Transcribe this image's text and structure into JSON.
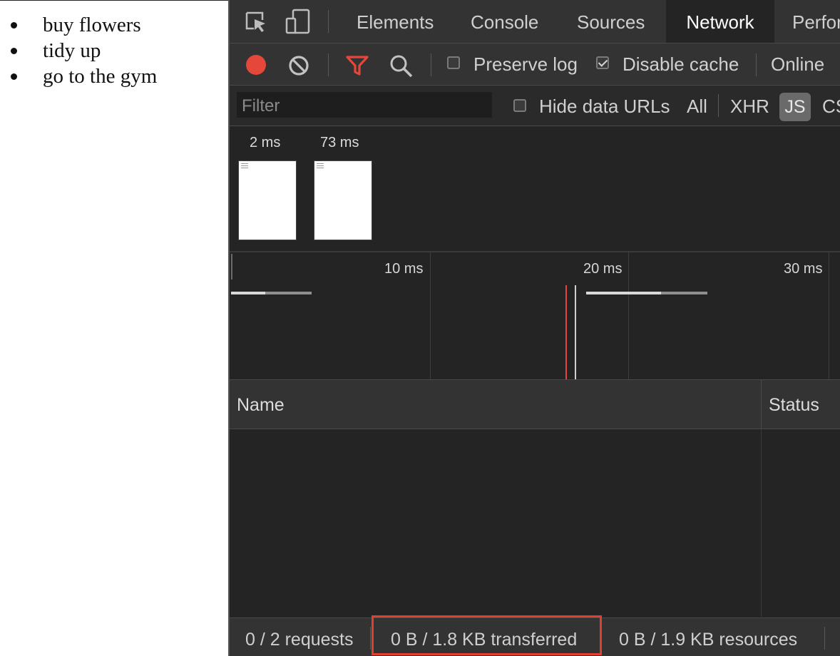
{
  "page": {
    "list_items": [
      "buy flowers",
      "tidy up",
      "go to the gym"
    ]
  },
  "devtools": {
    "tabs": [
      "Elements",
      "Console",
      "Sources",
      "Network",
      "Perfor"
    ],
    "active_tab": "Network",
    "toolbar": {
      "preserve_log_label": "Preserve log",
      "preserve_log_checked": false,
      "disable_cache_label": "Disable cache",
      "disable_cache_checked": true,
      "throttling": "Online"
    },
    "filterbar": {
      "placeholder": "Filter",
      "hide_data_urls_label": "Hide data URLs",
      "hide_data_urls_checked": false,
      "type_filters": [
        "All",
        "XHR",
        "JS",
        "CS"
      ],
      "active_type": "JS"
    },
    "screenshots": [
      {
        "time": "2 ms"
      },
      {
        "time": "73 ms"
      }
    ],
    "overview": {
      "ticks": [
        "10 ms",
        "20 ms",
        "30 ms"
      ]
    },
    "table": {
      "columns": [
        "Name",
        "Status"
      ]
    },
    "status": {
      "requests": "0 / 2 requests",
      "transferred": "0 B / 1.8 KB transferred",
      "resources": "0 B / 1.9 KB resources"
    },
    "colors": {
      "record": "#e5473a",
      "filter_icon": "#e5473a",
      "highlight": "#e2402f",
      "load_line": "#e5473a"
    },
    "icons": [
      "inspect-element-icon",
      "device-toolbar-icon",
      "record-icon",
      "clear-icon",
      "filter-icon",
      "search-icon"
    ]
  }
}
